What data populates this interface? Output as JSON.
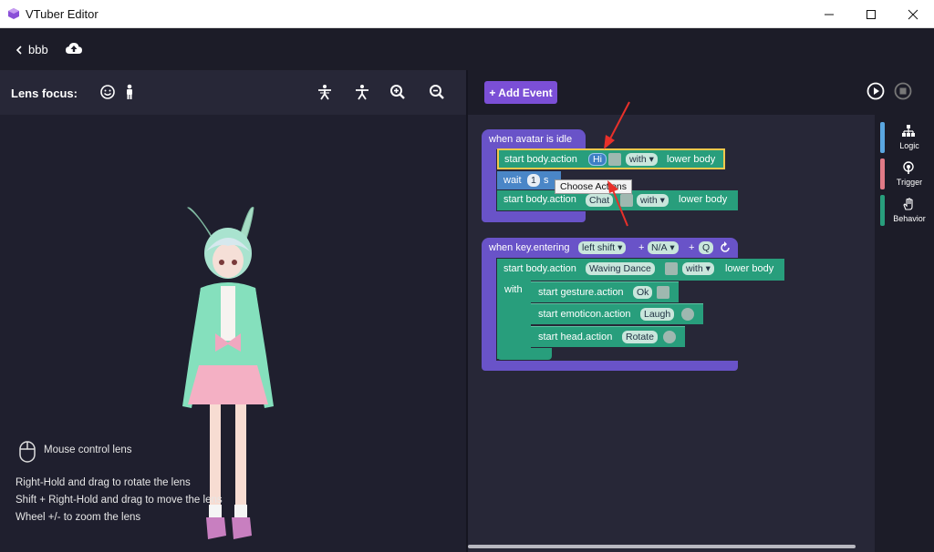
{
  "window": {
    "title": "VTuber Editor"
  },
  "toolbar": {
    "project_name": "bbb"
  },
  "left": {
    "lens_label": "Lens focus:",
    "help": {
      "title": "Mouse control lens",
      "line1": "Right-Hold and drag to rotate the lens",
      "line2": "Shift + Right-Hold and drag to move the lens",
      "line3": "Wheel +/- to zoom the lens"
    }
  },
  "right": {
    "add_event_label": "+ Add Event",
    "sidebar": [
      {
        "label": "Logic",
        "color": "#5aa6e0"
      },
      {
        "label": "Trigger",
        "color": "#e07a86"
      },
      {
        "label": "Behavior",
        "color": "#289e7c"
      }
    ]
  },
  "blocks": {
    "event1": {
      "header": "when avatar is idle",
      "row1": {
        "prefix": "start body.action",
        "value": "Hi",
        "with": "with",
        "suffix": "lower body"
      },
      "row2": {
        "prefix": "wait",
        "value": "1",
        "suffix": "s"
      },
      "row3": {
        "prefix": "start body.action",
        "value": "Chat",
        "with": "with",
        "suffix": "lower body"
      },
      "tooltip": "Choose Actions"
    },
    "event2": {
      "header": "when key.entering",
      "key1": "left shift",
      "plus1": "+",
      "key2": "N/A",
      "plus2": "+",
      "key3": "Q",
      "row1": {
        "prefix": "start body.action",
        "value": "Waving Dance",
        "with": "with",
        "suffix": "lower body"
      },
      "with_label": "with",
      "sub1": {
        "prefix": "start gesture.action",
        "value": "Ok"
      },
      "sub2": {
        "prefix": "start emoticon.action",
        "value": "Laugh"
      },
      "sub3": {
        "prefix": "start head.action",
        "value": "Rotate"
      }
    }
  },
  "colors": {
    "accent": "#7b4fd6",
    "block_purple": "#6953c8",
    "block_green": "#289e7c",
    "highlight": "#f2c94c"
  }
}
